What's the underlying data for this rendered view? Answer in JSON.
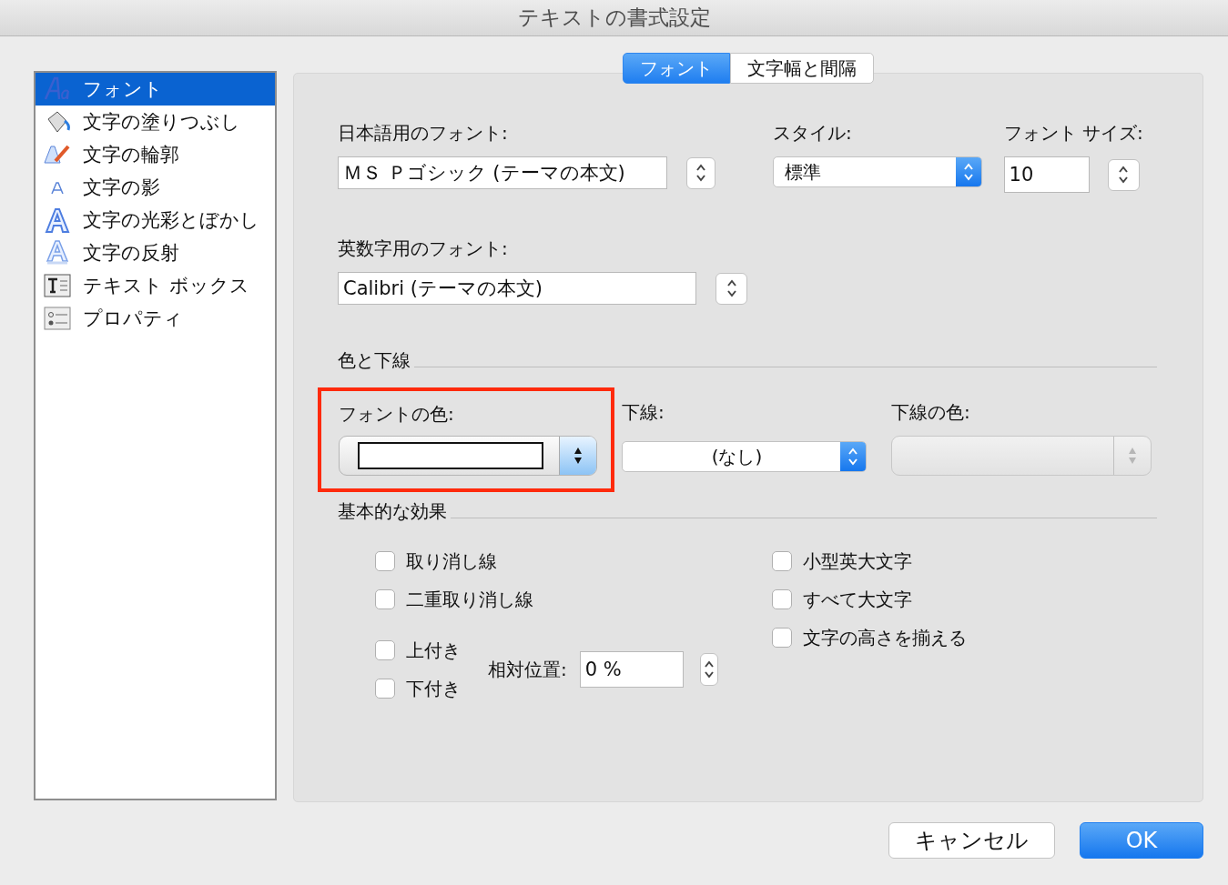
{
  "window": {
    "title": "テキストの書式設定"
  },
  "sidebar": {
    "items": [
      {
        "label": "フォント",
        "selected": true,
        "kind": "font"
      },
      {
        "label": "文字の塗りつぶし",
        "selected": false,
        "kind": "fill"
      },
      {
        "label": "文字の輪郭",
        "selected": false,
        "kind": "outline"
      },
      {
        "label": "文字の影",
        "selected": false,
        "kind": "shadow"
      },
      {
        "label": "文字の光彩とぼかし",
        "selected": false,
        "kind": "glow"
      },
      {
        "label": "文字の反射",
        "selected": false,
        "kind": "reflection"
      },
      {
        "label": "テキスト ボックス",
        "selected": false,
        "kind": "textbox"
      },
      {
        "label": "プロパティ",
        "selected": false,
        "kind": "properties"
      }
    ]
  },
  "tabs": [
    {
      "label": "フォント",
      "selected": true
    },
    {
      "label": "文字幅と間隔",
      "selected": false
    }
  ],
  "font": {
    "japanese_label": "日本語用のフォント:",
    "japanese_value": "ＭＳ Ｐゴシック (テーマの本文)",
    "style_label": "スタイル:",
    "style_value": "標準",
    "size_label": "フォント サイズ:",
    "size_value": "10",
    "latin_label": "英数字用のフォント:",
    "latin_value": "Calibri (テーマの本文)"
  },
  "color_underline": {
    "heading": "色と下線",
    "font_color_label": "フォントの色:",
    "font_color_highlighted": true,
    "underline_label": "下線:",
    "underline_value": "(なし)",
    "underline_color_label": "下線の色:",
    "underline_color_disabled": true
  },
  "effects": {
    "heading": "基本的な効果",
    "left": [
      {
        "label": "取り消し線",
        "checked": false
      },
      {
        "label": "二重取り消し線",
        "checked": false
      }
    ],
    "position": [
      {
        "label": "上付き",
        "checked": false
      },
      {
        "label": "下付き",
        "checked": false
      }
    ],
    "offset_label": "相対位置:",
    "offset_value": "0 %",
    "right": [
      {
        "label": "小型英大文字",
        "checked": false
      },
      {
        "label": "すべて大文字",
        "checked": false
      },
      {
        "label": "文字の高さを揃える",
        "checked": false
      }
    ]
  },
  "buttons": [
    {
      "label": "キャンセル",
      "kind": "default"
    },
    {
      "label": "OK",
      "kind": "primary"
    }
  ]
}
